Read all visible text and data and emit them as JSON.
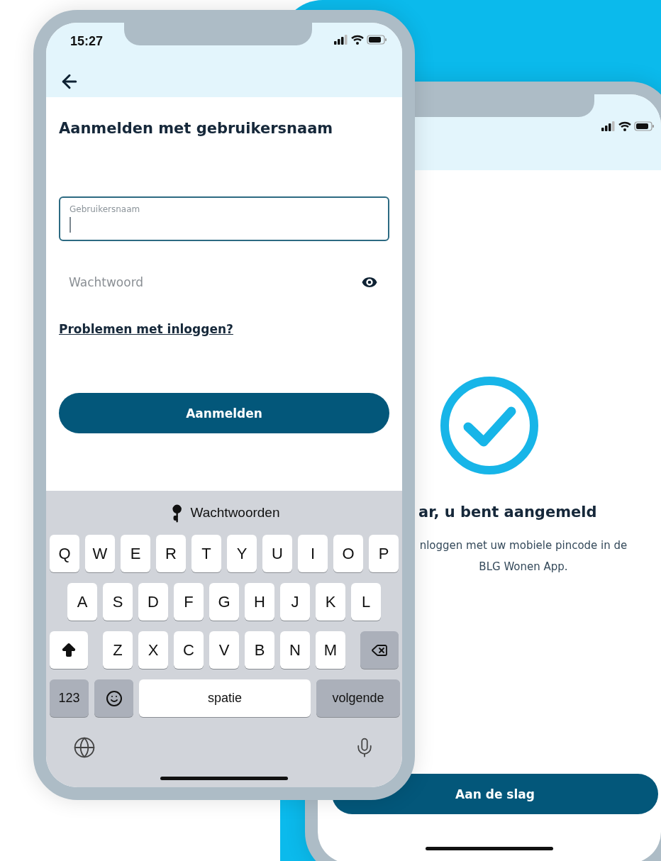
{
  "login_screen": {
    "status_time": "15:27",
    "title": "Aanmelden met gebruikersnaam",
    "username_field": {
      "label": "Gebruikersnaam"
    },
    "password_field": {
      "placeholder": "Wachtwoord"
    },
    "help_link": "Problemen met inloggen?",
    "submit_button": "Aanmelden",
    "keyboard": {
      "suggestion": "Wachtwoorden",
      "rows": [
        [
          "Q",
          "W",
          "E",
          "R",
          "T",
          "Y",
          "U",
          "I",
          "O",
          "P"
        ],
        [
          "A",
          "S",
          "D",
          "F",
          "G",
          "H",
          "J",
          "K",
          "L"
        ],
        [
          "Z",
          "X",
          "C",
          "V",
          "B",
          "N",
          "M"
        ]
      ],
      "numbers_key": "123",
      "space_key": "spatie",
      "return_key": "volgende"
    }
  },
  "success_screen": {
    "title": "ar, u bent aangemeld",
    "message": "nloggen met uw mobiele pincode in de BLG Wonen App.",
    "button": "Aan de slag"
  }
}
